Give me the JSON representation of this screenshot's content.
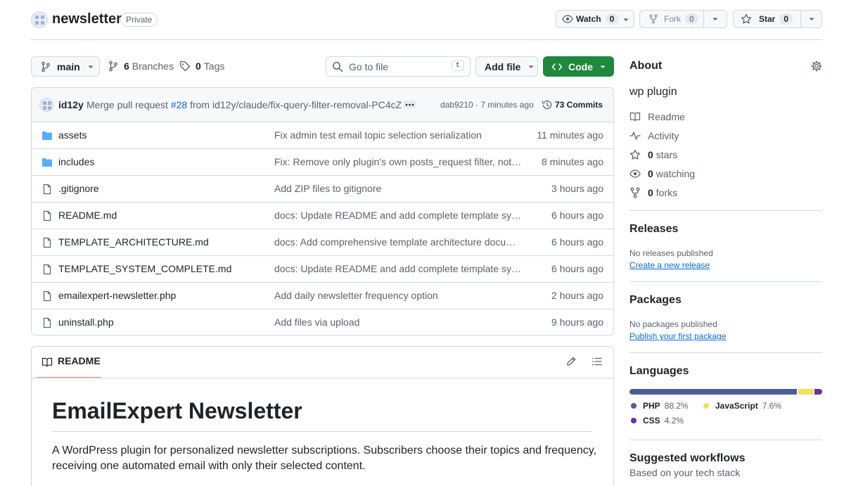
{
  "repo": {
    "name": "newsletter",
    "visibility": "Private"
  },
  "actions": {
    "watch_label": "Watch",
    "watch_count": "0",
    "fork_label": "Fork",
    "fork_count": "0",
    "star_label": "Star",
    "star_count": "0"
  },
  "toolbar": {
    "branch": "main",
    "branches_count": "6",
    "branches_label": "Branches",
    "tags_count": "0",
    "tags_label": "Tags",
    "search_placeholder": "Go to file",
    "search_shortcut": "t",
    "add_file_label": "Add file",
    "code_label": "Code"
  },
  "commit": {
    "author": "id12y",
    "message_prefix": "Merge pull request",
    "pr_link": "#28",
    "message_suffix": "from id12y/claude/fix-query-filter-removal-PC4cZ",
    "sha_time": "dab9210 · 7 minutes ago",
    "commits_label": "73 Commits"
  },
  "files": [
    {
      "type": "folder",
      "name": "assets",
      "message": "Fix admin test email topic selection serialization",
      "time": "11 minutes ago"
    },
    {
      "type": "folder",
      "name": "includes",
      "message": "Fix: Remove only plugin's own posts_request filter, not all …",
      "time": "8 minutes ago"
    },
    {
      "type": "file",
      "name": ".gitignore",
      "message": "Add ZIP files to gitignore",
      "time": "3 hours ago"
    },
    {
      "type": "file",
      "name": "README.md",
      "message": "docs: Update README and add complete template syste…",
      "time": "6 hours ago"
    },
    {
      "type": "file",
      "name": "TEMPLATE_ARCHITECTURE.md",
      "message": "docs: Add comprehensive template architecture docume…",
      "time": "6 hours ago"
    },
    {
      "type": "file",
      "name": "TEMPLATE_SYSTEM_COMPLETE.md",
      "message": "docs: Update README and add complete template syste…",
      "time": "6 hours ago"
    },
    {
      "type": "file",
      "name": "emailexpert-newsletter.php",
      "message": "Add daily newsletter frequency option",
      "time": "2 hours ago"
    },
    {
      "type": "file",
      "name": "uninstall.php",
      "message": "Add files via upload",
      "time": "9 hours ago"
    }
  ],
  "readme": {
    "tab_label": "README",
    "heading": "EmailExpert Newsletter",
    "paragraph_line1": "A WordPress plugin for personalized newsletter subscriptions. Subscribers choose their topics and frequency,",
    "paragraph_line2": "receiving one automated email with only their selected content."
  },
  "about": {
    "title": "About",
    "description": "wp plugin",
    "readme": "Readme",
    "activity": "Activity",
    "stars_count": "0",
    "stars_label": "stars",
    "watching_count": "0",
    "watching_label": "watching",
    "forks_count": "0",
    "forks_label": "forks"
  },
  "releases": {
    "title": "Releases",
    "empty": "No releases published",
    "link": "Create a new release"
  },
  "packages": {
    "title": "Packages",
    "empty": "No packages published",
    "link": "Publish your first package"
  },
  "languages": {
    "title": "Languages",
    "items": [
      {
        "name": "PHP",
        "percent": "88.2%",
        "value": 88.2,
        "color": "#4F5D95"
      },
      {
        "name": "JavaScript",
        "percent": "7.6%",
        "value": 7.6,
        "color": "#f1e05a"
      },
      {
        "name": "CSS",
        "percent": "4.2%",
        "value": 4.2,
        "color": "#663399"
      }
    ]
  },
  "workflows": {
    "title": "Suggested workflows",
    "subtitle": "Based on your tech stack"
  }
}
